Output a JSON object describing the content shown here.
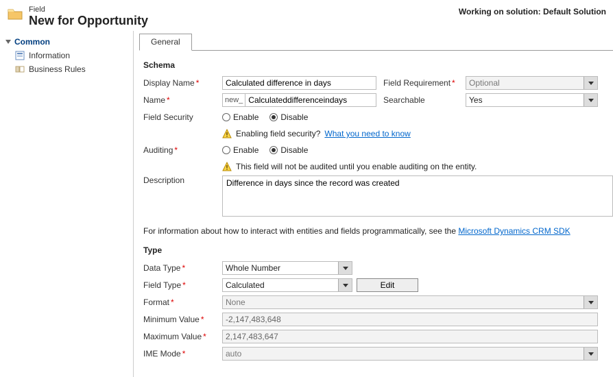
{
  "header": {
    "sub": "Field",
    "title": "New for Opportunity",
    "right": "Working on solution: Default Solution"
  },
  "sidebar": {
    "group": "Common",
    "items": [
      {
        "label": "Information"
      },
      {
        "label": "Business Rules"
      }
    ]
  },
  "tabs": {
    "general": "General"
  },
  "schema": {
    "section": "Schema",
    "displayNameLabel": "Display Name",
    "displayName": "Calculated difference in days",
    "fieldReqLabel": "Field Requirement",
    "fieldReq": "Optional",
    "nameLabel": "Name",
    "namePrefix": "new_",
    "name": "Calculateddifferenceindays",
    "searchableLabel": "Searchable",
    "searchable": "Yes",
    "fieldSecurityLabel": "Field Security",
    "enable": "Enable",
    "disable": "Disable",
    "securityHint": "Enabling field security?",
    "securityLink": "What you need to know",
    "auditingLabel": "Auditing",
    "auditingHint": "This field will not be audited until you enable auditing on the entity.",
    "descriptionLabel": "Description",
    "description": "Difference in days since the record was created",
    "sdkHintPrefix": "For information about how to interact with entities and fields programmatically, see the ",
    "sdkLink": "Microsoft Dynamics CRM SDK"
  },
  "type": {
    "section": "Type",
    "dataTypeLabel": "Data Type",
    "dataType": "Whole Number",
    "fieldTypeLabel": "Field Type",
    "fieldType": "Calculated",
    "editBtn": "Edit",
    "formatLabel": "Format",
    "format": "None",
    "minLabel": "Minimum Value",
    "min": "-2,147,483,648",
    "maxLabel": "Maximum Value",
    "max": "2,147,483,647",
    "imeLabel": "IME Mode",
    "ime": "auto"
  }
}
